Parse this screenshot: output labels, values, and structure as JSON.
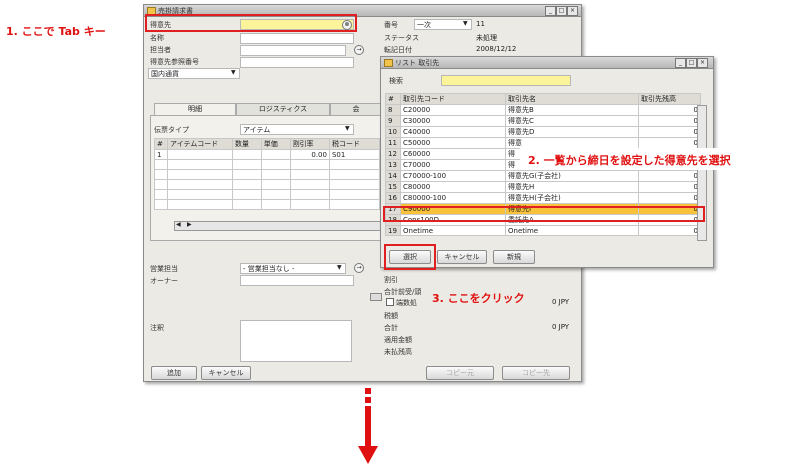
{
  "annotations": {
    "step1": "1. ここで Tab キー",
    "step2": "2. 一覧から締日を設定した得意先を選択",
    "step3": "3. ここをクリック"
  },
  "main_window": {
    "title": "売掛請求書",
    "fields": {
      "customer_label": "得意先",
      "name_label": "名称",
      "contact_label": "担当者",
      "reference_label": "得意先参照番号",
      "currency_value": "国内通貨"
    },
    "right_fields": {
      "number_label": "番号",
      "number_series": "一次",
      "number_value": "11",
      "status_label": "ステータス",
      "status_value": "未処理",
      "posting_date_label": "転記日付",
      "posting_date_value": "2008/12/12"
    },
    "tabs": [
      "明細",
      "ロジスティクス",
      "会"
    ],
    "item_type_label": "伝票タイプ",
    "item_type_value": "アイテム",
    "grid_headers": [
      "#",
      "アイテムコード",
      "数量",
      "単価",
      "割引率",
      "税コード"
    ],
    "grid_row1": {
      "num": "1",
      "discount": "0.00",
      "tax": "S01"
    },
    "sales_emp_label": "営業担当",
    "sales_emp_value": "- 営業担当なし -",
    "owner_label": "オーナー",
    "remarks_label": "注釈",
    "totals": {
      "discount_label": "割引",
      "dp_label": "合計前受/頭",
      "rounding_label": "端数処",
      "rounding_value": "0 JPY",
      "tax_label": "税額",
      "total_label": "合計",
      "total_value": "0 JPY",
      "applied_label": "適用金額",
      "balance_label": "未払残高"
    },
    "buttons": {
      "add": "追加",
      "cancel": "キャンセル",
      "copy_from": "コピー元",
      "copy_to": "コピー先"
    }
  },
  "list_window": {
    "title": "リスト 取引先",
    "search_label": "検索",
    "columns": [
      "#",
      "取引先コード",
      "取引先名",
      "取引先残高"
    ],
    "rows": [
      {
        "num": "8",
        "code": "C20000",
        "name": "得意先B",
        "balance": "0"
      },
      {
        "num": "9",
        "code": "C30000",
        "name": "得意先C",
        "balance": "0"
      },
      {
        "num": "10",
        "code": "C40000",
        "name": "得意先D",
        "balance": "0"
      },
      {
        "num": "11",
        "code": "C50000",
        "name": "得意",
        "balance": "0"
      },
      {
        "num": "12",
        "code": "C60000",
        "name": "得",
        "balance": "0"
      },
      {
        "num": "13",
        "code": "C70000",
        "name": "得",
        "balance": "0"
      },
      {
        "num": "14",
        "code": "C70000-100",
        "name": "得意先G(子会社)",
        "balance": "0"
      },
      {
        "num": "15",
        "code": "C80000",
        "name": "得意先H",
        "balance": "0"
      },
      {
        "num": "16",
        "code": "C80000-100",
        "name": "得意先H(子会社)",
        "balance": "0"
      },
      {
        "num": "17",
        "code": "C90000",
        "name": "得意先I",
        "balance": "0"
      },
      {
        "num": "18",
        "code": "Cons100D",
        "name": "委託先A",
        "balance": "0"
      },
      {
        "num": "19",
        "code": "Onetime",
        "name": "Onetime",
        "balance": "0"
      }
    ],
    "selected_index": 9,
    "buttons": {
      "select": "選択",
      "cancel": "キャンセル",
      "new": "新規"
    }
  },
  "colors": {
    "accent_red": "#e01010",
    "selected_row": "#f8c23a",
    "search_yellow": "#fbf49a"
  }
}
